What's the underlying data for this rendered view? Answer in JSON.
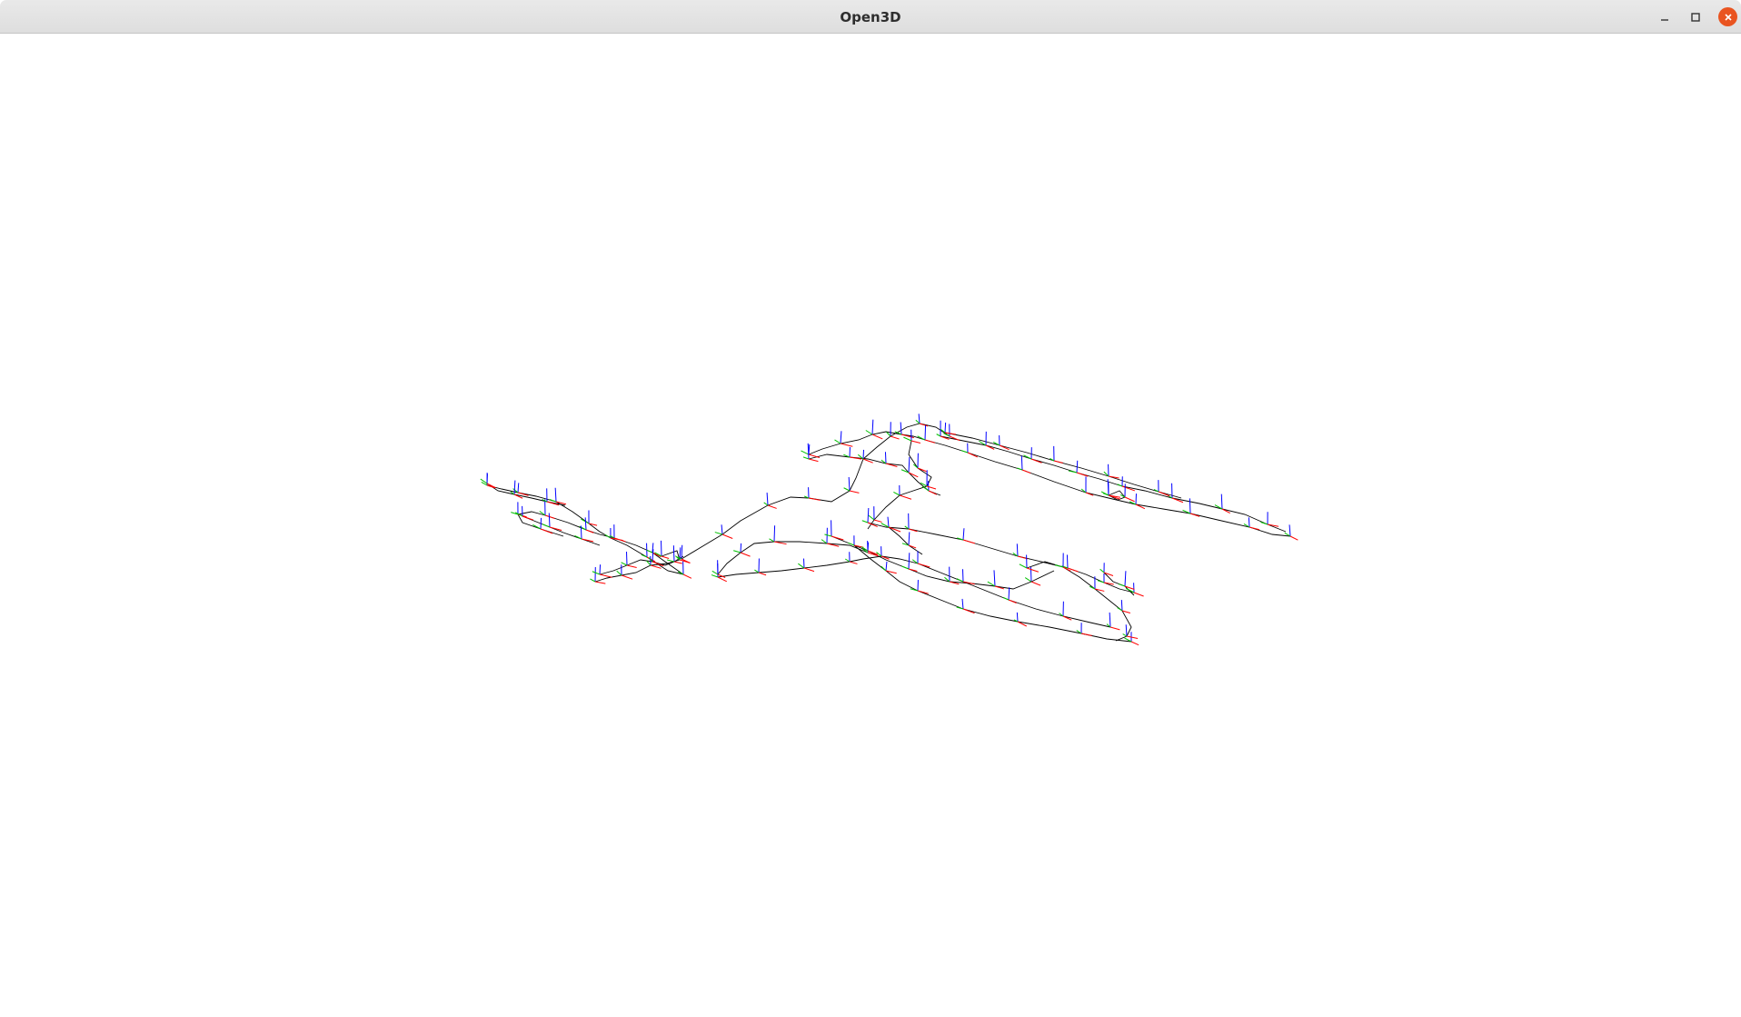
{
  "window": {
    "title": "Open3D",
    "controls": {
      "minimize_icon": "minimize-icon",
      "maximize_icon": "maximize-icon",
      "close_icon": "close-icon",
      "close_color": "#e95420"
    }
  },
  "scene": {
    "background_color": "#ffffff",
    "edge_color": "#000000",
    "axis_colors": {
      "x": "#ff0000",
      "y": "#00c000",
      "z": "#0000ff"
    }
  }
}
